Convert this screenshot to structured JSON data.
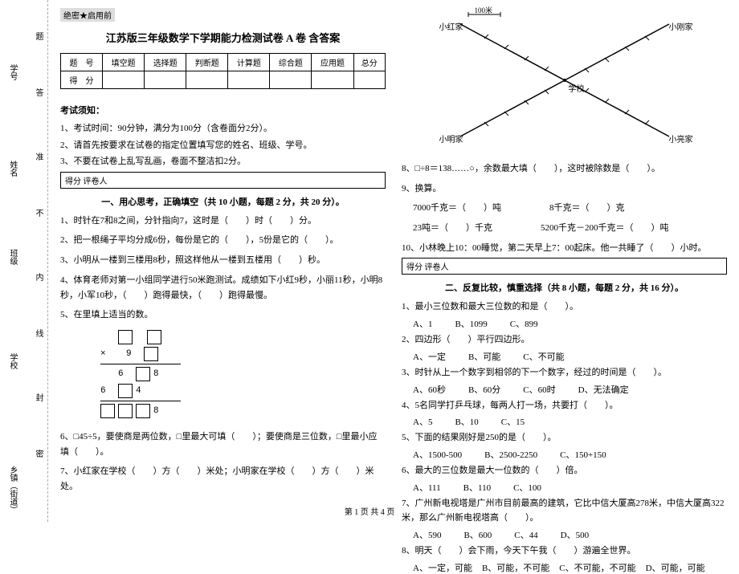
{
  "binding": {
    "l1": "乡镇（街道）",
    "l2": "学校",
    "l3": "班级",
    "l4": "姓名",
    "l5": "学号",
    "d1": "密",
    "d2": "封",
    "d3": "线",
    "d4": "内",
    "d5": "不",
    "d6": "准",
    "d7": "答",
    "d8": "题"
  },
  "secret": "绝密★启用前",
  "title": "江苏版三年级数学下学期能力检测试卷 A 卷 含答案",
  "score_table": {
    "r1": [
      "题　号",
      "填空题",
      "选择题",
      "判断题",
      "计算题",
      "综合题",
      "应用题",
      "总分"
    ],
    "r2": [
      "得　分",
      "",
      "",
      "",
      "",
      "",
      "",
      ""
    ]
  },
  "notice_h": "考试须知：",
  "notice": [
    "1、考试时间：90分钟，满分为100分（含卷面分2分）。",
    "2、请首先按要求在试卷的指定位置填写您的姓名、班级、学号。",
    "3、不要在试卷上乱写乱画，卷面不整洁扣2分。"
  ],
  "tbox": "得分   评卷人",
  "s1": {
    "h": "一、用心思考，正确填空（共 10 小题，每题 2 分，共 20 分）。",
    "q1": "1、时针在7和8之间，分针指向7，这时是（　　）时（　　）分。",
    "q2": "2、把一根绳子平均分成6份，每份是它的（　　），5份是它的（　　）。",
    "q3": "3、小明从一楼到三楼用8秒，照这样他从一楼到五楼用（　　）秒。",
    "q4": "4、体育老师对第一小组同学进行50米跑测试。成绩如下小红9秒，小丽11秒，小明8秒，小军10秒，（　　）跑得最快，（　　）跑得最慢。",
    "q5": "5、在里填上适当的数。",
    "q6": "6、□45÷5，要使商是两位数，□里最大可填（　　）；要使商是三位数，□里最小应填（　　）。",
    "q7": "7、小红家在学校（　　）方（　　）米处；小明家在学校（　　）方（　　）米处。"
  },
  "diagram": {
    "hundred": "100米",
    "hong": "小红家",
    "gang": "小刚家",
    "ming": "小明家",
    "liang": "小亮家",
    "school": "学校"
  },
  "s1b": {
    "q8": "8、□÷8＝138……○，余数最大填（　　），这时被除数是（　　）。",
    "q9": "9、换算。",
    "q9a": "7000千克＝（　　）吨",
    "q9b": "8千克＝（　　）克",
    "q9c": "23吨＝（　　）千克",
    "q9d": "5200千克－200千克＝（　　）吨",
    "q10": "10、小林晚上10：00睡觉，第二天早上7：00起床。他一共睡了（　　）小时。"
  },
  "s2": {
    "h": "二、反复比较，慎重选择（共 8 小题，每题 2 分，共 16 分）。",
    "q1": "1、最小三位数和最大三位数的和是（　　）。",
    "q1o": [
      "A、1",
      "B、1099",
      "C、899"
    ],
    "q2": "2、四边形（　　）平行四边形。",
    "q2o": [
      "A、一定",
      "B、可能",
      "C、不可能"
    ],
    "q3": "3、时针从上一个数字到相邻的下一个数字，经过的时间是（　　）。",
    "q3o": [
      "A、60秒",
      "B、60分",
      "C、60时",
      "D、无法确定"
    ],
    "q4": "4、5名同学打乒乓球，每两人打一场，共要打（　　）。",
    "q4o": [
      "A、5",
      "B、10",
      "C、15"
    ],
    "q5": "5、下面的结果刚好是250的是（　　）。",
    "q5o": [
      "A、1500-500",
      "B、2500-2250",
      "C、150+150"
    ],
    "q6": "6、最大的三位数是最大一位数的（　　）倍。",
    "q6o": [
      "A、111",
      "B、110",
      "C、100"
    ],
    "q7": "7、广州新电视塔是广州市目前最高的建筑，它比中信大厦高278米，中信大厦高322米，那么广州新电视塔高（　　）。",
    "q7o": [
      "A、590",
      "B、600",
      "C、44",
      "D、500"
    ],
    "q8": "8、明天（　　）会下雨，今天下午我（　　）游遍全世界。",
    "q8o": [
      "A、一定，可能",
      "B、可能，不可能",
      "C、不可能，不可能",
      "D、可能，可能"
    ]
  },
  "footer": "第 1 页 共 4 页"
}
